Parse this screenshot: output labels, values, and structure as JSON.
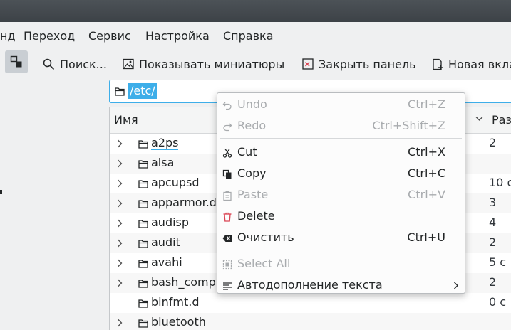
{
  "menubar": {
    "items": [
      "нд",
      "Переход",
      "Сервис",
      "Настройка",
      "Справка"
    ]
  },
  "toolbar": {
    "search": "Поиск...",
    "preview": "Показывать миниатюры",
    "close_panel": "Закрыть панель",
    "new_tab": "Новая вкла"
  },
  "address": {
    "value": "/etc/"
  },
  "columns": {
    "name": "Имя",
    "size": "Раз"
  },
  "files": [
    {
      "name": "a2ps",
      "size": "2",
      "expandable": true
    },
    {
      "name": "alsa",
      "size": "",
      "expandable": true
    },
    {
      "name": "apcupsd",
      "size": "10 с",
      "expandable": true
    },
    {
      "name": "apparmor.d",
      "size": "3",
      "expandable": true
    },
    {
      "name": "audisp",
      "size": "4",
      "expandable": true
    },
    {
      "name": "audit",
      "size": "2",
      "expandable": true
    },
    {
      "name": "avahi",
      "size": "5 с",
      "expandable": true
    },
    {
      "name": "bash_comp",
      "size": "2",
      "expandable": true
    },
    {
      "name": "binfmt.d",
      "size": "0 с",
      "expandable": false
    },
    {
      "name": "bluetooth",
      "size": "",
      "expandable": true
    }
  ],
  "context_menu": {
    "undo": {
      "label": "Undo",
      "shortcut": "Ctrl+Z"
    },
    "redo": {
      "label": "Redo",
      "shortcut": "Ctrl+Shift+Z"
    },
    "cut": {
      "label": "Cut",
      "shortcut": "Ctrl+X"
    },
    "copy": {
      "label": "Copy",
      "shortcut": "Ctrl+C"
    },
    "paste": {
      "label": "Paste",
      "shortcut": "Ctrl+V"
    },
    "delete": {
      "label": "Delete"
    },
    "clear": {
      "label": "Очистить",
      "shortcut": "Ctrl+U"
    },
    "select_all": {
      "label": "Select All"
    },
    "autocomplete": {
      "label": "Автодополнение текста"
    }
  },
  "colors": {
    "accent": "#3daee9",
    "disabled": "#a8abae",
    "delete": "#da4453"
  }
}
